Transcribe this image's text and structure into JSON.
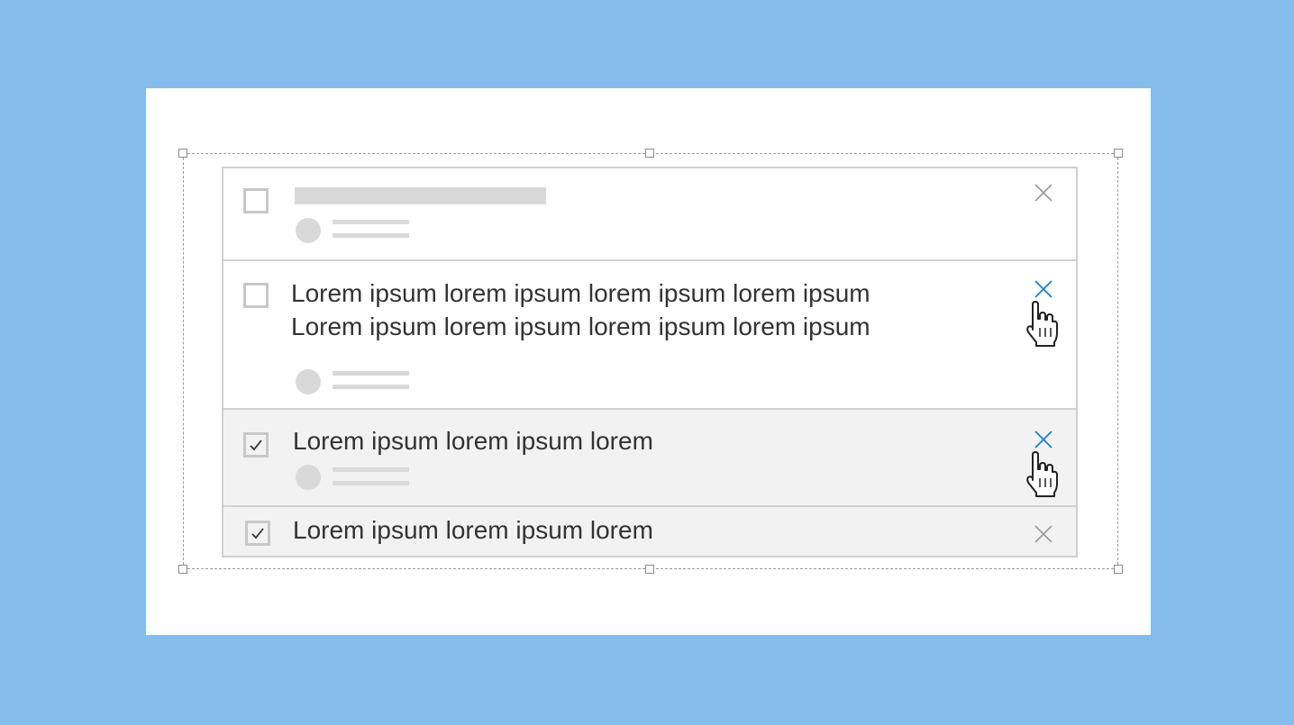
{
  "colors": {
    "background": "#84bdeb",
    "card": "#ffffff",
    "border": "#d0d0d0",
    "placeholder": "#d9d9d9",
    "checked_row": "#f2f2f2",
    "close_active": "#1a7fd4",
    "close_inactive": "#9a9a9a",
    "text": "#333333"
  },
  "list": {
    "items": [
      {
        "state": "loading",
        "checked": false,
        "close": "inactive",
        "icon": "close-icon"
      },
      {
        "state": "hover",
        "checked": false,
        "close": "active",
        "icon": "close-icon",
        "lines": [
          "Lorem ipsum lorem ipsum lorem ipsum lorem ipsum",
          "Lorem ipsum lorem ipsum lorem ipsum lorem ipsum"
        ]
      },
      {
        "state": "hover",
        "checked": true,
        "close": "active",
        "icon": "close-icon",
        "lines": [
          "Lorem ipsum lorem ipsum lorem"
        ]
      },
      {
        "state": "default",
        "checked": true,
        "close": "inactive",
        "icon": "close-icon",
        "lines": [
          "Lorem ipsum lorem ipsum lorem"
        ]
      }
    ]
  }
}
